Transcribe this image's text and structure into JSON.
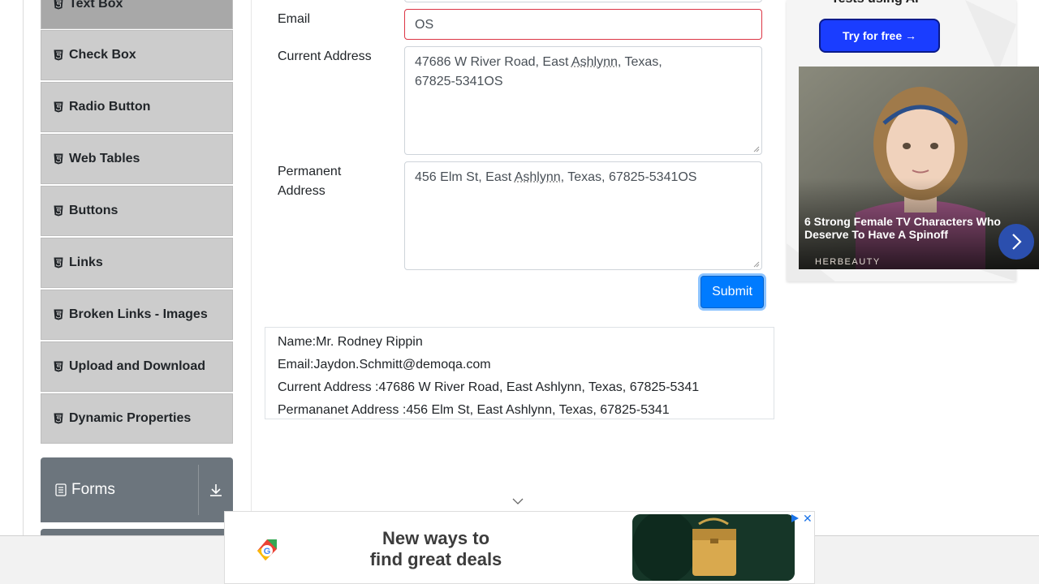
{
  "sidebar": {
    "items": [
      {
        "label": "Text Box",
        "active": true
      },
      {
        "label": "Check Box"
      },
      {
        "label": "Radio Button"
      },
      {
        "label": "Web Tables"
      },
      {
        "label": "Buttons"
      },
      {
        "label": "Links"
      },
      {
        "label": "Broken Links - Images"
      },
      {
        "label": "Upload and Download"
      },
      {
        "label": "Dynamic Properties"
      }
    ],
    "forms_group_label": "Forms"
  },
  "form": {
    "email_label": "Email",
    "email_value": "OS",
    "current_address_label": "Current Address",
    "current_address_value_pre": "47686 W River Road, East ",
    "current_address_value_misspelled": "Ashlynn",
    "current_address_value_post": ", Texas,",
    "current_address_value_line2": "67825-5341OS",
    "permanent_address_label_line1": "Permanent",
    "permanent_address_label_line2": "Address",
    "permanent_address_value_pre": "456 Elm St, East ",
    "permanent_address_value_misspelled": "Ashlynn",
    "permanent_address_value_post": ", Texas, 67825-5341OS",
    "submit_label": "Submit"
  },
  "output": {
    "name": "Name:Mr. Rodney Rippin",
    "email": "Email:Jaydon.Schmitt@demoqa.com",
    "current_address": "Current Address :47686 W River Road, East Ashlynn, Texas, 67825-5341",
    "permanent_address": "Permananet Address :456 Elm St, East Ashlynn, Texas, 67825-5341"
  },
  "ad_right": {
    "top_text": "Tests using AI",
    "button_label": "Try for free →",
    "caption": "6 Strong Female TV Characters Who Deserve To Have A Spinoff",
    "brand": "HERBEAUTY"
  },
  "ad_bottom": {
    "headline_line1": "New ways to",
    "headline_line2": "find great deals",
    "close_label": "✕"
  },
  "colors": {
    "accent": "#007bff",
    "error_border": "#dc3545",
    "sidebar_item": "#cccccc",
    "sidebar_active": "#a8a8a8",
    "forms_group": "#6c757d"
  }
}
